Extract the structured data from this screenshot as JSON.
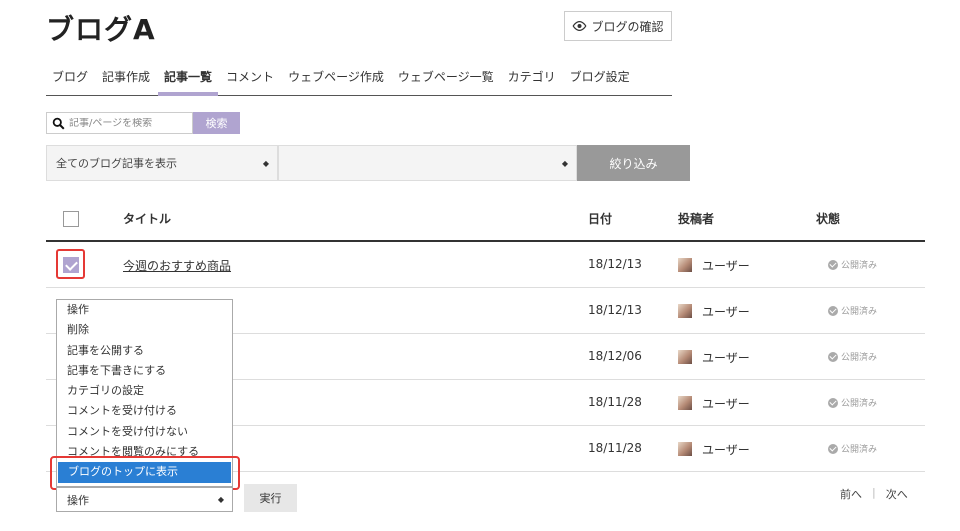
{
  "header": {
    "title": "ブログA",
    "preview_label": "ブログの確認"
  },
  "tabs": [
    {
      "label": "ブログ"
    },
    {
      "label": "記事作成"
    },
    {
      "label": "記事一覧",
      "active": true
    },
    {
      "label": "コメント"
    },
    {
      "label": "ウェブページ作成"
    },
    {
      "label": "ウェブページ一覧"
    },
    {
      "label": "カテゴリ"
    },
    {
      "label": "ブログ設定"
    }
  ],
  "search": {
    "placeholder": "記事/ページを検索",
    "button_label": "検索"
  },
  "filter": {
    "select1": "全てのブログ記事を表示",
    "select2": "",
    "button_label": "絞り込み"
  },
  "table": {
    "columns": {
      "title": "タイトル",
      "date": "日付",
      "author": "投稿者",
      "status": "状態"
    },
    "rows": [
      {
        "title": "今週のおすすめ商品",
        "date": "18/12/13",
        "author": "ユーザー",
        "status": "公開済み",
        "checked": true
      },
      {
        "title": "",
        "date": "18/12/13",
        "author": "ユーザー",
        "status": "公開済み"
      },
      {
        "title": "",
        "date": "18/12/06",
        "author": "ユーザー",
        "status": "公開済み"
      },
      {
        "title": "",
        "date": "18/11/28",
        "author": "ユーザー",
        "status": "公開済み"
      },
      {
        "title": "",
        "date": "18/11/28",
        "author": "ユーザー",
        "status": "公開済み"
      }
    ]
  },
  "action_menu": {
    "options": [
      "操作",
      "削除",
      "記事を公開する",
      "記事を下書きにする",
      "カテゴリの設定",
      "コメントを受け付ける",
      "コメントを受け付けない",
      "コメントを閲覧のみにする",
      "ブログのトップに表示"
    ],
    "selected_option": "ブログのトップに表示",
    "current_value": "操作",
    "execute_label": "実行"
  },
  "pager": {
    "prev_label": "前へ",
    "separator": "|",
    "next_label": "次へ"
  },
  "colors": {
    "accent": "#b0a4d0",
    "highlight": "#e53935",
    "selected": "#2a7fd4"
  }
}
